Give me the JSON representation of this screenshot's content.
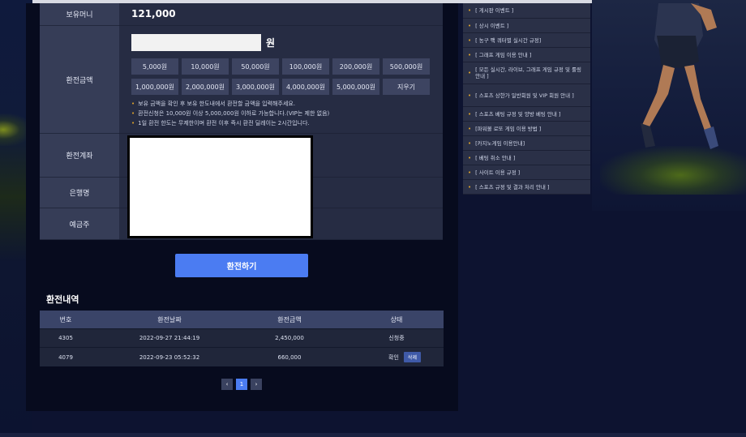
{
  "form": {
    "balance_label": "보유머니",
    "balance_value": "121,000",
    "amount_label": "환전금액",
    "amount_input_value": "",
    "currency_unit": "원",
    "amount_buttons": [
      "5,000원",
      "10,000원",
      "50,000원",
      "100,000원",
      "200,000원",
      "500,000원",
      "1,000,000원",
      "2,000,000원",
      "3,000,000원",
      "4,000,000원",
      "5,000,000원",
      "지우기"
    ],
    "notes": [
      "보유 금액을 확인 후 보유 한도내에서 환전할 금액을 입력해주세요.",
      "환전신청은 10,000원 이상 5,000,000원 이하로 가능합니다.(VIP는 제한 없음)",
      "1일 환전 한도는 무제한이며 환전 이후 즉시 환전 딜레이는 2시간입니다."
    ],
    "account_label": "환전계좌",
    "bank_label": "은행명",
    "holder_label": "예금주",
    "submit_label": "환전하기"
  },
  "history": {
    "title": "환전내역",
    "columns": [
      "번호",
      "환전날짜",
      "환전금액",
      "상태"
    ],
    "rows": [
      {
        "no": "4305",
        "date": "2022-09-27 21:44:19",
        "amount": "2,450,000",
        "status": "신청중"
      },
      {
        "no": "4079",
        "date": "2022-09-23 05:52:32",
        "amount": "660,000",
        "status": "확인",
        "action": "삭제"
      }
    ],
    "pagination": {
      "prev": "‹",
      "current": "1",
      "next": "›"
    }
  },
  "sidebar": {
    "items": [
      "[ 게시판 이벤트 ]",
      "[ 상시 이벤트 ]",
      "[ 농구 팩 쿼터별 실시간 규정]",
      "[ 그래프 게임 이용 안내 ]",
      "[ 모든 실시간, 라이브, 그래프 게임 규정 및 룰링 안내 ]",
      "[ 스포츠 상한가 일반회원 및 VIP 회원 안내 ]",
      "[ 스포츠 베팅 규정 및 양방 베팅 안내 ]",
      "[파워볼 로또 게임 이용 방법 ]",
      "[카지노게임 이용안내]",
      "[ 베팅 취소 안내 ]",
      "[ 사이트 이용 규정 ]",
      "[ 스포츠 규정 및 결과 처리 안내 ]"
    ]
  },
  "colors": {
    "accent": "#4b7cf2",
    "bullet": "#e0a42a",
    "panel": "#262c43",
    "label_bg": "#363d57"
  }
}
